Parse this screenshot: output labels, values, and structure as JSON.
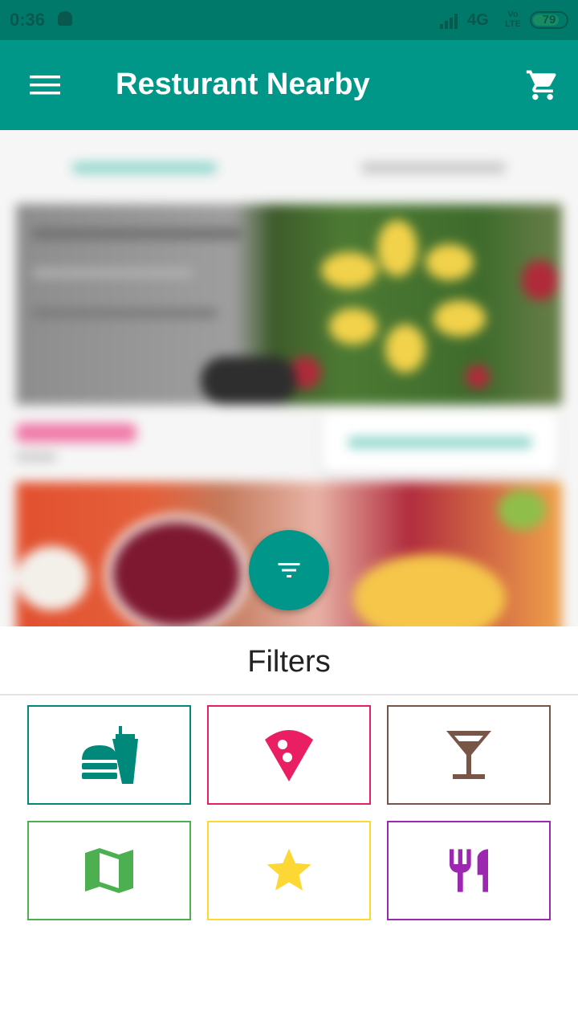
{
  "status_bar": {
    "time": "0:36",
    "network": "4G",
    "volte": "Vo LTE",
    "battery": "79",
    "battery_fraction": 0.79
  },
  "app_bar": {
    "title": "Resturant Nearby",
    "menu_icon": "hamburger-menu-icon",
    "cart_icon": "shopping-cart-icon"
  },
  "colors": {
    "primary": "#009688",
    "status_bar": "#00796b",
    "fab": "#00968a",
    "fast_food": "#00897b",
    "pizza": "#e91e63",
    "drinks": "#795548",
    "map": "#4caf50",
    "rating": "#fdd835",
    "restaurant": "#9c27b0"
  },
  "fab": {
    "icon": "filter-icon"
  },
  "filters": {
    "title": "Filters",
    "tiles": [
      {
        "icon": "fast-food-icon",
        "color": "#00897b"
      },
      {
        "icon": "pizza-icon",
        "color": "#e91e63"
      },
      {
        "icon": "cocktail-icon",
        "color": "#795548"
      },
      {
        "icon": "map-icon",
        "color": "#4caf50"
      },
      {
        "icon": "star-icon",
        "color": "#fdd835"
      },
      {
        "icon": "restaurant-icon",
        "color": "#9c27b0"
      }
    ]
  }
}
